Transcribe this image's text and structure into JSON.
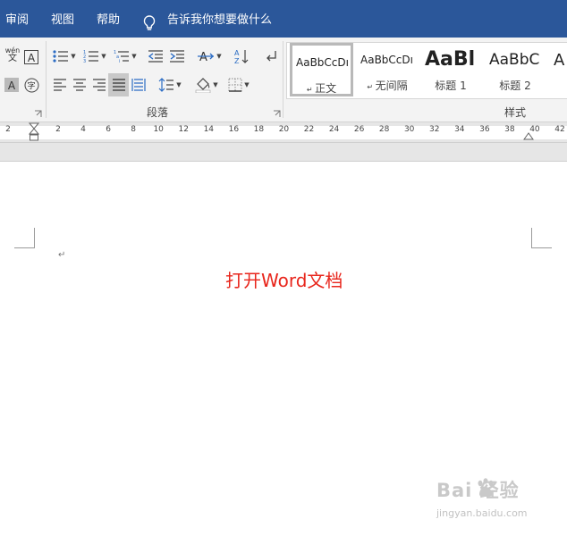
{
  "menu": {
    "items": [
      "审阅",
      "视图",
      "帮助"
    ],
    "tell_me": "告诉我你想要做什么"
  },
  "ribbon": {
    "font_group": {
      "phonetic_glyph": "wén",
      "phonetic_sub": "文",
      "enclose_glyph": "字"
    },
    "paragraph_group": {
      "label": "段落"
    },
    "styles_group": {
      "label": "样式",
      "items": [
        {
          "sample": "AaBbCcDı",
          "name": "正文",
          "selected": true
        },
        {
          "sample": "AaBbCcDı",
          "name": "无间隔",
          "selected": false
        },
        {
          "sample": "AaBl",
          "name": "标题 1",
          "selected": false
        },
        {
          "sample": "AaBbC",
          "name": "标题 2",
          "selected": false
        },
        {
          "sample": "A",
          "name": "",
          "selected": false
        }
      ]
    }
  },
  "ruler": {
    "labels": [
      "2",
      "2",
      "4",
      "6",
      "8",
      "10",
      "12",
      "14",
      "16",
      "18",
      "20",
      "22",
      "24",
      "26",
      "28",
      "30",
      "32",
      "34",
      "36",
      "38",
      "40",
      "42"
    ]
  },
  "document": {
    "paragraph_mark": "↵",
    "text": "打开Word文档"
  },
  "watermark": {
    "brand": "Bai  经验",
    "url": "jingyan.baidu.com"
  },
  "colors": {
    "menubar": "#2b579a",
    "ribbon": "#f3f3f3",
    "document_text": "#e8261c",
    "accent_blue": "#2b6cc4"
  }
}
